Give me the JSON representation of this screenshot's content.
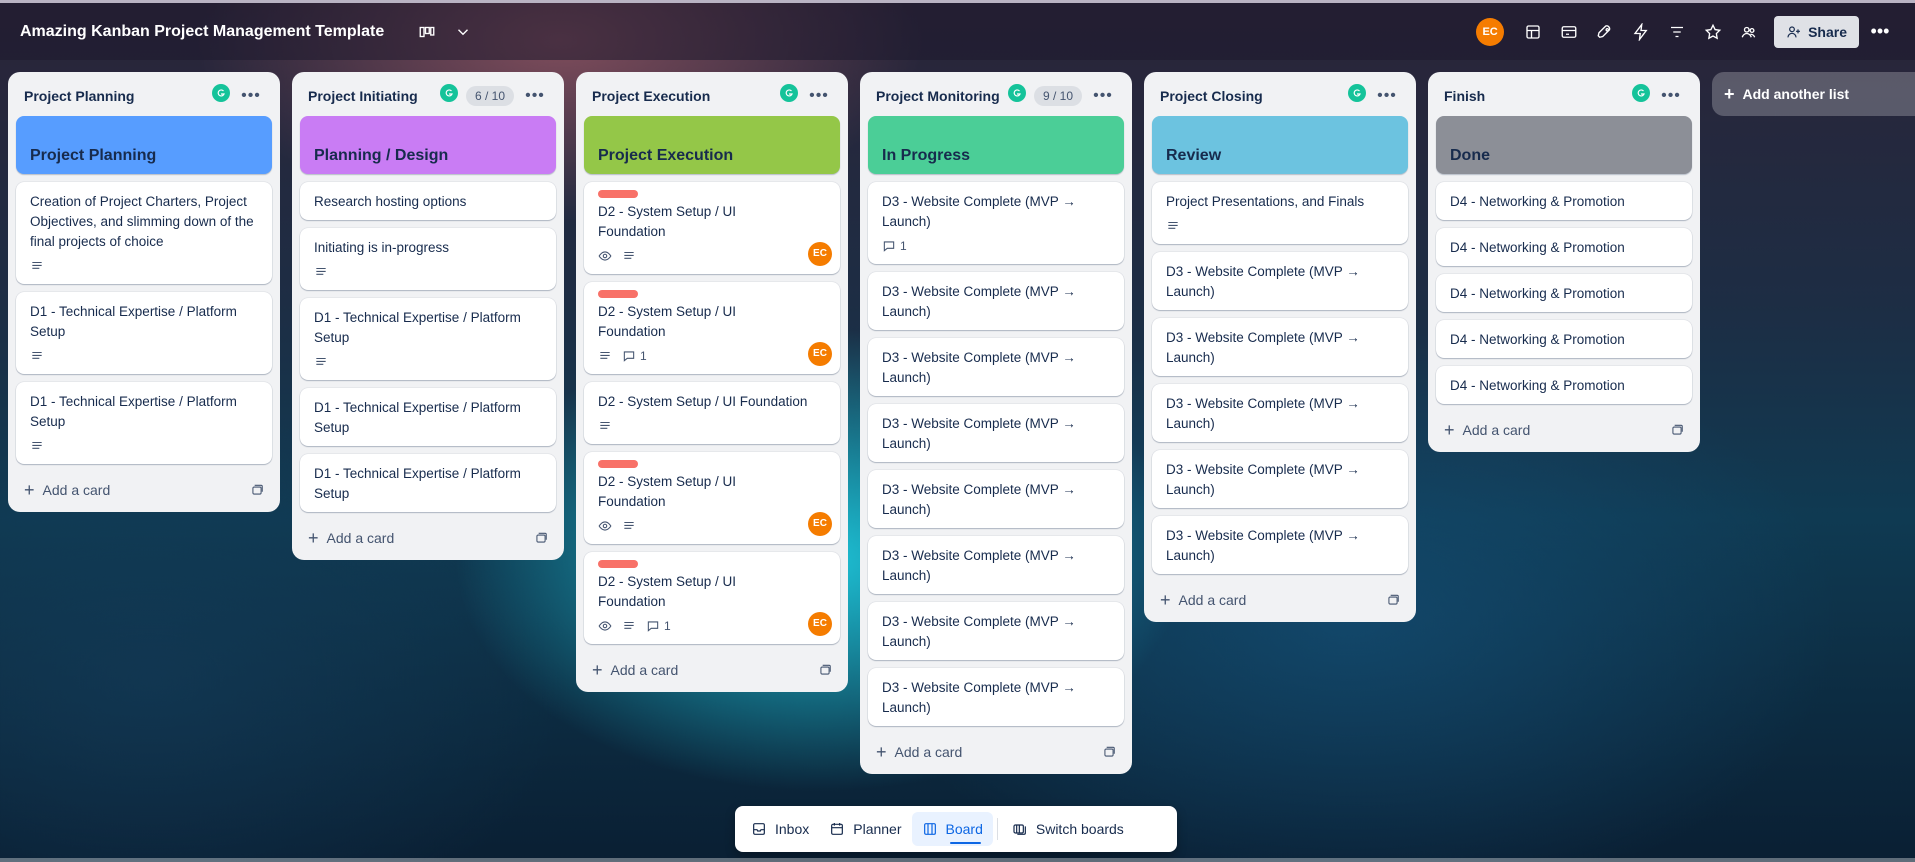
{
  "header": {
    "board_title": "Amazing Kanban Project Management Template",
    "avatar_initials": "EC",
    "share_label": "Share"
  },
  "lists": [
    {
      "title": "Project Planning",
      "count": "",
      "cover": {
        "text": "Project Planning",
        "color": "#579dff"
      },
      "cards": [
        {
          "text": "Creation of Project Charters, Project Objectives, and slimming down of the final projects of choice",
          "label": false,
          "watch": false,
          "desc": true,
          "comments": "",
          "member": ""
        },
        {
          "text": "D1 - Technical Expertise / Platform Setup",
          "label": false,
          "watch": false,
          "desc": true,
          "comments": "",
          "member": ""
        },
        {
          "text": "D1 - Technical Expertise / Platform Setup",
          "label": false,
          "watch": false,
          "desc": true,
          "comments": "",
          "member": ""
        }
      ],
      "add_card": "Add a card"
    },
    {
      "title": "Project Initiating",
      "count": "6 / 10",
      "cover": {
        "text": "Planning / Design",
        "color": "#c97cf4"
      },
      "cards": [
        {
          "text": "Research hosting options",
          "label": false,
          "watch": false,
          "desc": false,
          "comments": "",
          "member": ""
        },
        {
          "text": "Initiating is in-progress",
          "label": false,
          "watch": false,
          "desc": true,
          "comments": "",
          "member": ""
        },
        {
          "text": "D1 - Technical Expertise / Platform Setup",
          "label": false,
          "watch": false,
          "desc": true,
          "comments": "",
          "member": ""
        },
        {
          "text": "D1 - Technical Expertise / Platform Setup",
          "label": false,
          "watch": false,
          "desc": false,
          "comments": "",
          "member": ""
        },
        {
          "text": "D1 - Technical Expertise / Platform Setup",
          "label": false,
          "watch": false,
          "desc": false,
          "comments": "",
          "member": ""
        }
      ],
      "add_card": "Add a card"
    },
    {
      "title": "Project Execution",
      "count": "",
      "cover": {
        "text": "Project Execution",
        "color": "#94c748"
      },
      "cards": [
        {
          "text": "D2 - System Setup / UI Foundation",
          "label": true,
          "watch": true,
          "desc": true,
          "comments": "",
          "member": "EC"
        },
        {
          "text": "D2 - System Setup / UI Foundation",
          "label": true,
          "watch": false,
          "desc": true,
          "comments": "1",
          "member": "EC"
        },
        {
          "text": "D2 - System Setup / UI Foundation",
          "label": false,
          "watch": false,
          "desc": true,
          "comments": "",
          "member": ""
        },
        {
          "text": "D2 - System Setup / UI Foundation",
          "label": true,
          "watch": true,
          "desc": true,
          "comments": "",
          "member": "EC"
        },
        {
          "text": "D2 - System Setup / UI Foundation",
          "label": true,
          "watch": true,
          "desc": true,
          "comments": "1",
          "member": "EC"
        }
      ],
      "add_card": "Add a card"
    },
    {
      "title": "Project Monitoring",
      "count": "9 / 10",
      "cover": {
        "text": "In Progress",
        "color": "#4bce97"
      },
      "cards": [
        {
          "text": "D3 - Website Complete (MVP → Launch)",
          "label": false,
          "watch": false,
          "desc": false,
          "comments": "1",
          "member": ""
        },
        {
          "text": "D3 - Website Complete (MVP → Launch)",
          "label": false,
          "watch": false,
          "desc": false,
          "comments": "",
          "member": ""
        },
        {
          "text": "D3 - Website Complete (MVP → Launch)",
          "label": false,
          "watch": false,
          "desc": false,
          "comments": "",
          "member": ""
        },
        {
          "text": "D3 - Website Complete (MVP → Launch)",
          "label": false,
          "watch": false,
          "desc": false,
          "comments": "",
          "member": ""
        },
        {
          "text": "D3 - Website Complete (MVP → Launch)",
          "label": false,
          "watch": false,
          "desc": false,
          "comments": "",
          "member": ""
        },
        {
          "text": "D3 - Website Complete (MVP → Launch)",
          "label": false,
          "watch": false,
          "desc": false,
          "comments": "",
          "member": ""
        },
        {
          "text": "D3 - Website Complete (MVP → Launch)",
          "label": false,
          "watch": false,
          "desc": false,
          "comments": "",
          "member": ""
        },
        {
          "text": "D3 - Website Complete (MVP → Launch)",
          "label": false,
          "watch": false,
          "desc": false,
          "comments": "",
          "member": ""
        }
      ],
      "add_card": "Add a card"
    },
    {
      "title": "Project Closing",
      "count": "",
      "cover": {
        "text": "Review",
        "color": "#6cc3e0"
      },
      "cards": [
        {
          "text": "Project Presentations, and Finals",
          "label": false,
          "watch": false,
          "desc": true,
          "comments": "",
          "member": ""
        },
        {
          "text": "D3 - Website Complete (MVP → Launch)",
          "label": false,
          "watch": false,
          "desc": false,
          "comments": "",
          "member": ""
        },
        {
          "text": "D3 - Website Complete (MVP → Launch)",
          "label": false,
          "watch": false,
          "desc": false,
          "comments": "",
          "member": ""
        },
        {
          "text": "D3 - Website Complete (MVP → Launch)",
          "label": false,
          "watch": false,
          "desc": false,
          "comments": "",
          "member": ""
        },
        {
          "text": "D3 - Website Complete (MVP → Launch)",
          "label": false,
          "watch": false,
          "desc": false,
          "comments": "",
          "member": ""
        },
        {
          "text": "D3 - Website Complete (MVP → Launch)",
          "label": false,
          "watch": false,
          "desc": false,
          "comments": "",
          "member": ""
        }
      ],
      "add_card": "Add a card"
    },
    {
      "title": "Finish",
      "count": "",
      "cover": {
        "text": "Done",
        "color": "#8c8f97"
      },
      "cards": [
        {
          "text": "D4 - Networking & Promotion",
          "label": false,
          "watch": false,
          "desc": false,
          "comments": "",
          "member": ""
        },
        {
          "text": "D4 - Networking & Promotion",
          "label": false,
          "watch": false,
          "desc": false,
          "comments": "",
          "member": ""
        },
        {
          "text": "D4 - Networking & Promotion",
          "label": false,
          "watch": false,
          "desc": false,
          "comments": "",
          "member": ""
        },
        {
          "text": "D4 - Networking & Promotion",
          "label": false,
          "watch": false,
          "desc": false,
          "comments": "",
          "member": ""
        },
        {
          "text": "D4 - Networking & Promotion",
          "label": false,
          "watch": false,
          "desc": false,
          "comments": "",
          "member": ""
        }
      ],
      "add_card": "Add a card"
    }
  ],
  "add_list_label": "Add another list",
  "bottom_nav": {
    "inbox": "Inbox",
    "planner": "Planner",
    "board": "Board",
    "switch_boards": "Switch boards"
  }
}
